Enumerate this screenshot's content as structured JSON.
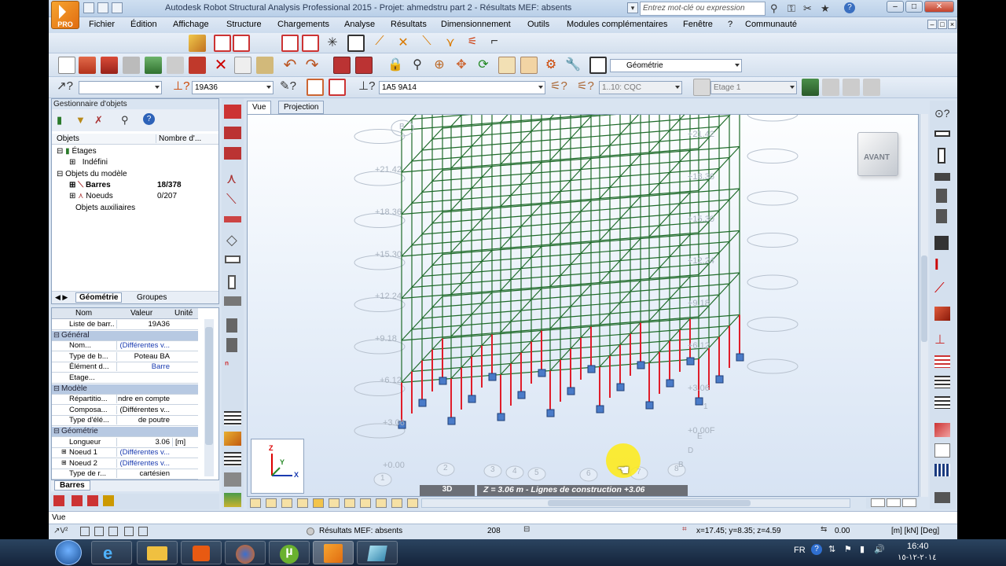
{
  "window": {
    "title": "Autodesk Robot Structural Analysis Professional 2015 - Projet: ahmedstru part 2 - Résultats MEF: absents",
    "logo_text": "PRO",
    "search_placeholder": "Entrez mot-clé ou expression",
    "minimize": "–",
    "restore": "□",
    "close": "✕"
  },
  "menu": [
    "Fichier",
    "Édition",
    "Affichage",
    "Structure",
    "Chargements",
    "Analyse",
    "Résultats",
    "Dimensionnement",
    "Outils",
    "Modules complémentaires",
    "Fenêtre",
    "?",
    "Communauté"
  ],
  "toolbar": {
    "geometry_combo": "Géométrie",
    "bars_combo": "",
    "section_combo": "19A36",
    "bars_list": "1A5 9A14",
    "cases_combo": "1..10: CQC",
    "storey_combo": "Etage 1"
  },
  "object_manager": {
    "title": "Gestionnaire d'objets",
    "col_objects": "Objets",
    "col_count": "Nombre d'...",
    "tree": [
      {
        "label": "Étages",
        "count": ""
      },
      {
        "label": "Indéfini",
        "count": ""
      },
      {
        "label": "Objets du modèle",
        "count": ""
      },
      {
        "label": "Barres",
        "count": "18/378"
      },
      {
        "label": "Noeuds",
        "count": "0/207"
      },
      {
        "label": "Objets auxiliaires",
        "count": ""
      }
    ],
    "tab_geometry": "Géométrie",
    "tab_groups": "Groupes"
  },
  "properties": {
    "col_name": "Nom",
    "col_value": "Valeur",
    "col_unit": "Unité",
    "rows": [
      {
        "type": "row",
        "key": "Liste de barr...",
        "value": "19A36",
        "unit": ""
      },
      {
        "type": "cat",
        "key": "Général"
      },
      {
        "type": "row",
        "key": "Nom...",
        "value": "(Différentes v...",
        "unit": "",
        "blue": true
      },
      {
        "type": "row",
        "key": "Type de b...",
        "value": "Poteau BA",
        "unit": ""
      },
      {
        "type": "row",
        "key": "Élément d...",
        "value": "Barre",
        "unit": "",
        "blue": true
      },
      {
        "type": "row",
        "key": "Etage...",
        "value": "",
        "unit": "",
        "blue": true
      },
      {
        "type": "cat",
        "key": "Modèle"
      },
      {
        "type": "row",
        "key": "Répartitio...",
        "value": "ndre en compte",
        "unit": ""
      },
      {
        "type": "row",
        "key": "Composa...",
        "value": "(Différentes v...",
        "unit": ""
      },
      {
        "type": "row",
        "key": "Type d'élé...",
        "value": "de poutre",
        "unit": ""
      },
      {
        "type": "cat",
        "key": "Géométrie"
      },
      {
        "type": "row",
        "key": "Longueur",
        "value": "3.06",
        "unit": "[m]"
      },
      {
        "type": "row",
        "key": "Noeud 1",
        "value": "(Différentes v...",
        "unit": "",
        "blue": true
      },
      {
        "type": "row",
        "key": "Noeud 2",
        "value": "(Différentes v...",
        "unit": "",
        "blue": true
      },
      {
        "type": "row",
        "key": "Type de r...",
        "value": "cartésien",
        "unit": ""
      }
    ],
    "tab": "Barres"
  },
  "view": {
    "tab_view": "Vue",
    "tab_projection": "Projection",
    "cube_label": "AVANT",
    "mode_3d": "3D",
    "status_text": "Z = 3.06 m - Lignes de construction +3.06",
    "right_levels": [
      "+21.42",
      "+18.36",
      "+15.30",
      "+12.24",
      "+9.18",
      "+6.12",
      "+3.06",
      "+0.00F"
    ],
    "left_levels": [
      "+21.42",
      "+18.36",
      "+15.30",
      "+12.24",
      "+9.18",
      "+6.12",
      "+3.06",
      "+0.00"
    ],
    "grid_bottom": [
      "1",
      "2",
      "3",
      "4",
      "5",
      "6",
      "7",
      "8"
    ],
    "grid_right": [
      "1",
      "E",
      "D",
      "B"
    ],
    "top_bubble": "B",
    "axis_z": "Z",
    "axis_y": "Y",
    "axis_x": "X"
  },
  "cmdline": "Vue",
  "status": {
    "results": "Résultats MEF: absents",
    "count": "208",
    "coords": "x=17.45; y=8.35; z=4.59",
    "value": "0.00",
    "units": "[m] [kN] [Deg]"
  },
  "taskbar": {
    "lang": "FR",
    "time": "16:40",
    "date": "٢٠١٤-١٢-١٥"
  }
}
